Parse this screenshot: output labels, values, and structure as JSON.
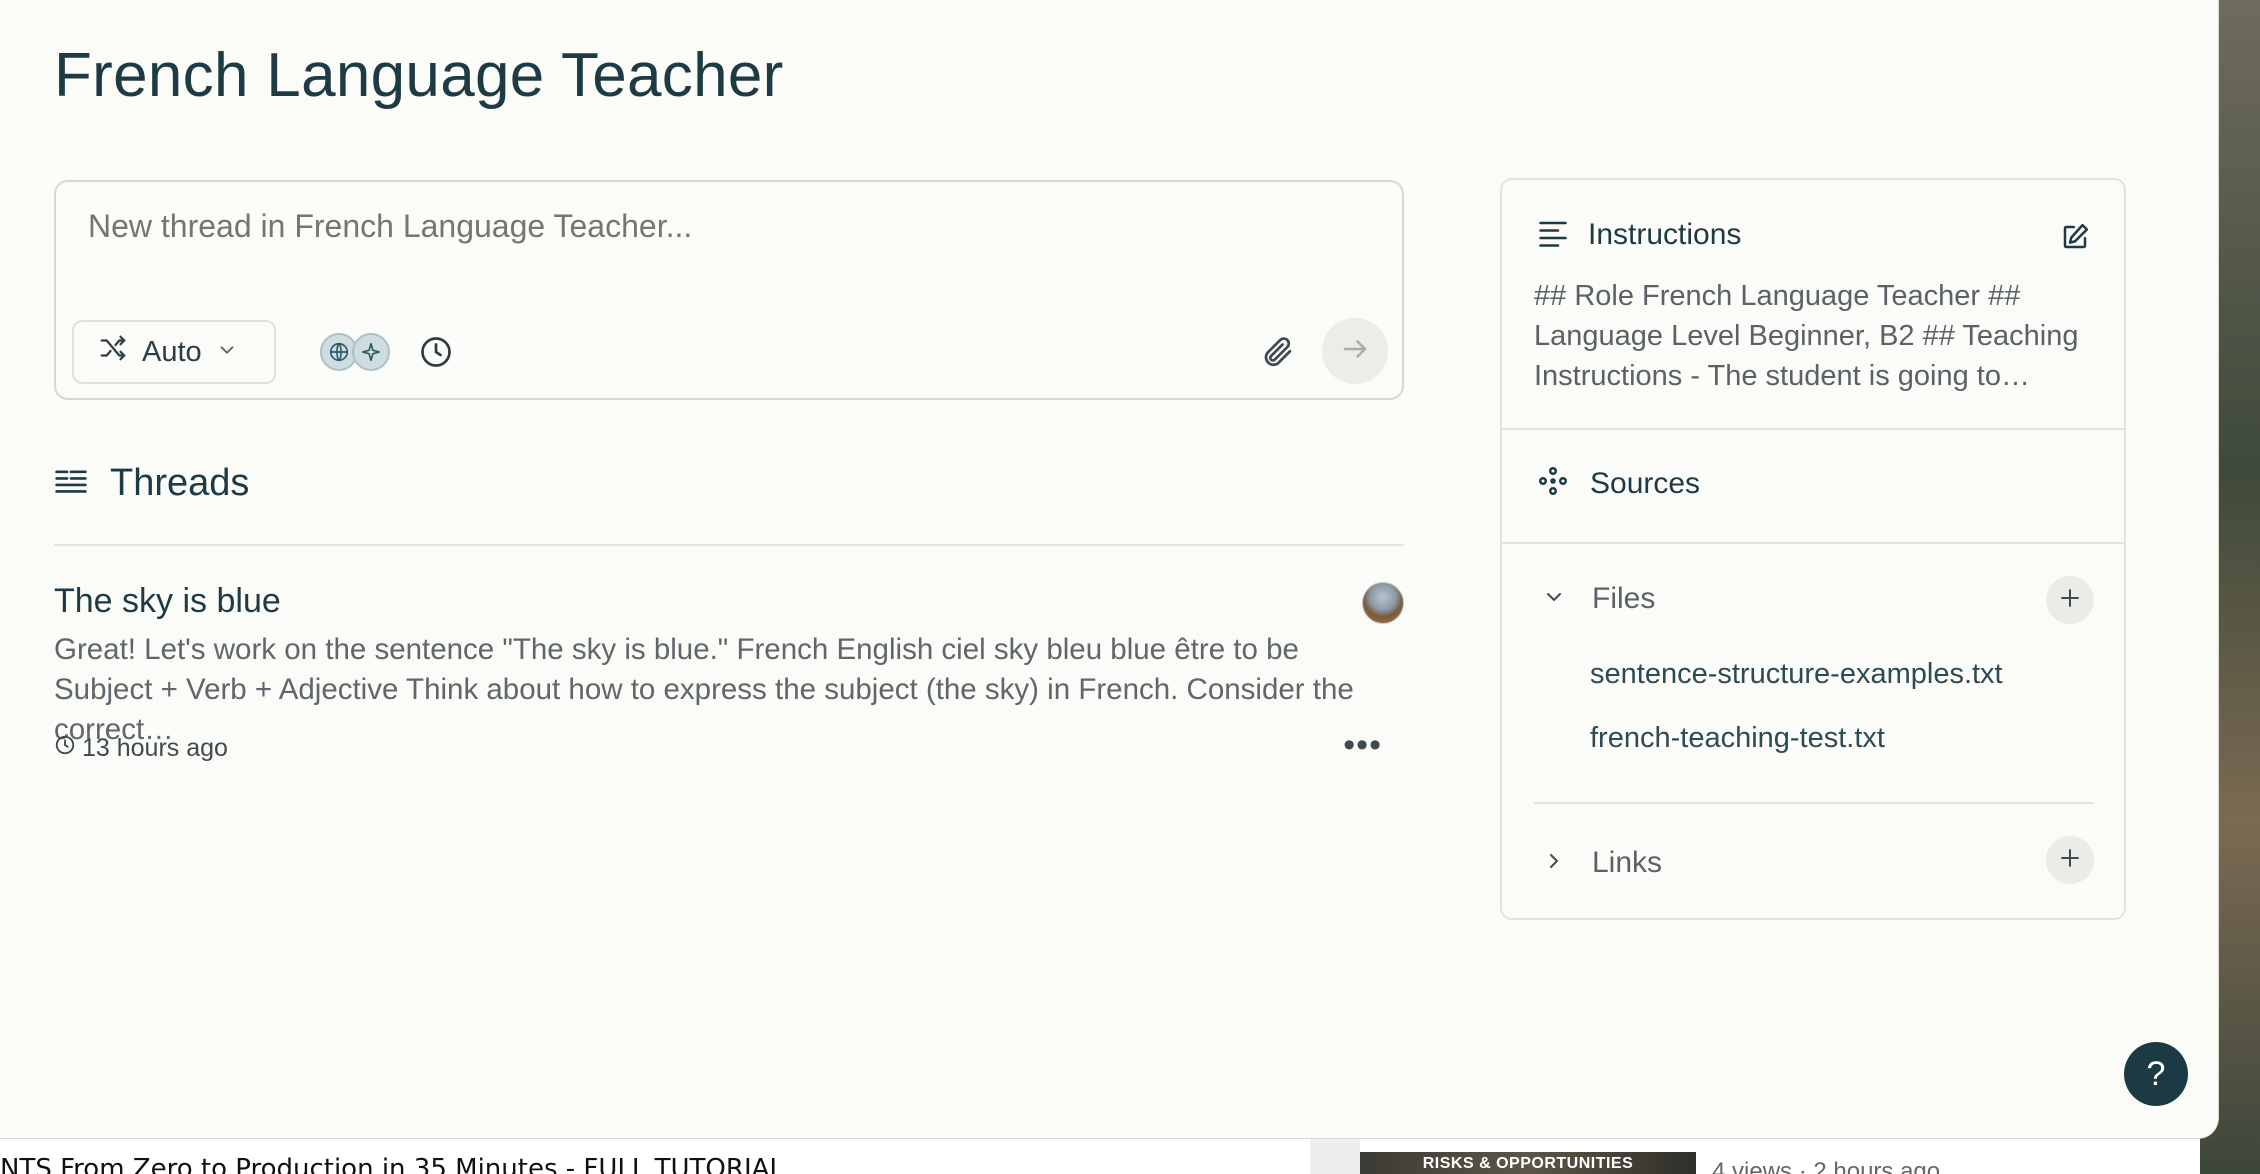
{
  "page": {
    "title": "French Language Teacher"
  },
  "composer": {
    "placeholder": "New thread in French Language Teacher...",
    "mode_label": "Auto"
  },
  "threads": {
    "heading": "Threads",
    "items": [
      {
        "title": "The sky is blue",
        "preview": "Great! Let's work on the sentence \"The sky is blue.\" French English ciel sky bleu blue être to be Subject + Verb + Adjective Think about how to express the subject (the sky) in French. Consider the correct…",
        "time": "13 hours ago"
      }
    ]
  },
  "panel": {
    "instructions": {
      "title": "Instructions",
      "text": "## Role French Language Teacher ## Language Level Beginner, B2 ## Teaching Instructions - The student is going to…"
    },
    "sources": {
      "title": "Sources"
    },
    "files": {
      "title": "Files",
      "items": [
        "sentence-structure-examples.txt",
        "french-teaching-test.txt"
      ]
    },
    "links": {
      "title": "Links"
    }
  },
  "help": {
    "label": "?"
  },
  "background_window": {
    "title": "NTS From Zero to Production in 35 Minutes - FULL TUTORIAL",
    "thumb_label": "RISKS & OPPORTUNITIES",
    "meta": "4 views · 2 hours ago"
  },
  "colors": {
    "background": "#fbfbf7",
    "text_primary": "#1d3a45",
    "help_button": "#1c3a44"
  },
  "icons": {
    "mode": "shuffle-icon",
    "focus": [
      "globe-icon",
      "sparkle-icon"
    ],
    "history": "clock-icon",
    "attach": "paperclip-icon",
    "send": "arrow-right-icon",
    "threads": "list-icon",
    "instructions": "text-lines-icon",
    "edit": "edit-icon",
    "sources": "nodes-icon"
  }
}
